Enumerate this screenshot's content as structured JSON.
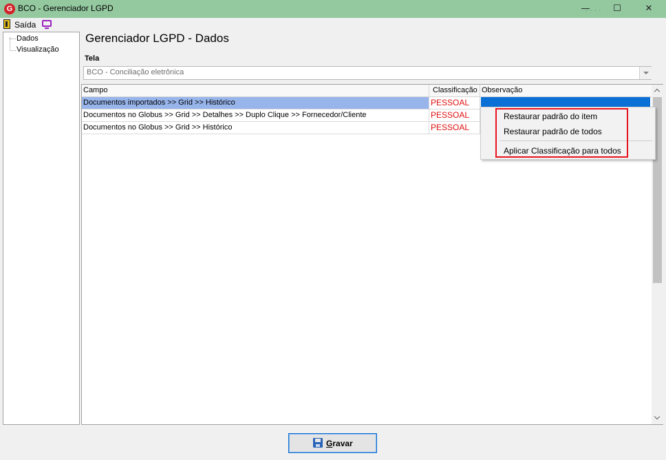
{
  "window": {
    "app_icon_letter": "G",
    "title": "BCO - Gerenciador LGPD",
    "dim_indicator": "....",
    "controls": {
      "minimize": "—",
      "maximize": "☐",
      "close": "✕"
    }
  },
  "menu": {
    "exit_label": "Saída",
    "exit_icon": "door-exit-icon",
    "monitor_icon": "monitor-icon"
  },
  "tree": {
    "items": [
      {
        "label": "Dados"
      },
      {
        "label": "Visualização"
      }
    ]
  },
  "main": {
    "page_title": "Gerenciador LGPD - Dados",
    "tela_label": "Tela",
    "tela_value": "BCO - Conciliação eletrônica"
  },
  "grid": {
    "columns": [
      "Campo",
      "Classificação",
      "Observação"
    ],
    "rows": [
      {
        "campo": "Documentos importados >> Grid >> Histórico",
        "classificacao": "PESSOAL",
        "observacao": "",
        "selected": true
      },
      {
        "campo": "Documentos no Globus >> Grid >> Detalhes >> Duplo Clique >> Fornecedor/Cliente",
        "classificacao": "PESSOAL",
        "observacao": "",
        "selected": false
      },
      {
        "campo": "Documentos no Globus >> Grid >> Histórico",
        "classificacao": "PESSOAL",
        "observacao": "",
        "selected": false
      }
    ]
  },
  "context_menu": {
    "items": [
      {
        "label": "Restaurar padrão do item"
      },
      {
        "label": "Restaurar padrão de todos"
      },
      {
        "label": "Aplicar Classificação para todos"
      }
    ]
  },
  "footer": {
    "save_label_first": "G",
    "save_label_rest": "ravar",
    "save_icon": "floppy-disk-icon"
  },
  "colors": {
    "titlebar": "#94c9a0",
    "selected_row": "#97b5eb",
    "selected_cell": "#0a70d5",
    "classification_text": "#e01010",
    "highlight_box": "#e8121e"
  }
}
